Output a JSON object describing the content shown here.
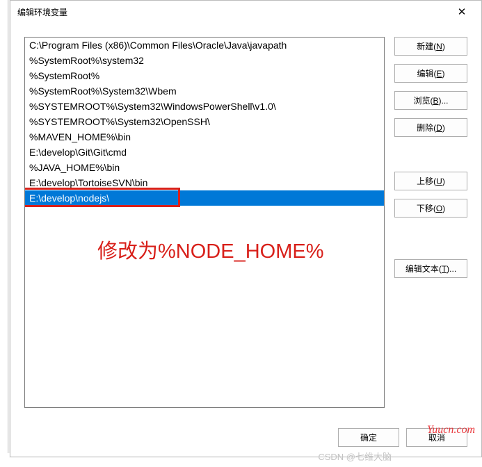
{
  "dialog": {
    "title": "编辑环境变量",
    "close_glyph": "✕"
  },
  "entries": [
    "C:\\Program Files (x86)\\Common Files\\Oracle\\Java\\javapath",
    "%SystemRoot%\\system32",
    "%SystemRoot%",
    "%SystemRoot%\\System32\\Wbem",
    "%SYSTEMROOT%\\System32\\WindowsPowerShell\\v1.0\\",
    "%SYSTEMROOT%\\System32\\OpenSSH\\",
    "%MAVEN_HOME%\\bin",
    "E:\\develop\\Git\\Git\\cmd",
    "%JAVA_HOME%\\bin",
    "E:\\develop\\TortoiseSVN\\bin",
    "E:\\develop\\nodejs\\"
  ],
  "selected_index": 10,
  "annotation": {
    "text": "修改为%NODE_HOME%"
  },
  "buttons": {
    "new": {
      "label": "新建(",
      "key": "N",
      "suffix": ")"
    },
    "edit": {
      "label": "编辑(",
      "key": "E",
      "suffix": ")"
    },
    "browse": {
      "label": "浏览(",
      "key": "B",
      "suffix": ")..."
    },
    "delete": {
      "label": "删除(",
      "key": "D",
      "suffix": ")"
    },
    "up": {
      "label": "上移(",
      "key": "U",
      "suffix": ")"
    },
    "down": {
      "label": "下移(",
      "key": "O",
      "suffix": ")"
    },
    "text": {
      "label": "编辑文本(",
      "key": "T",
      "suffix": ")..."
    }
  },
  "footer": {
    "ok": "确定",
    "cancel": "取消"
  },
  "watermarks": {
    "yuucn": "Yuucn.com",
    "csdn": "CSDN @七维大脑"
  }
}
